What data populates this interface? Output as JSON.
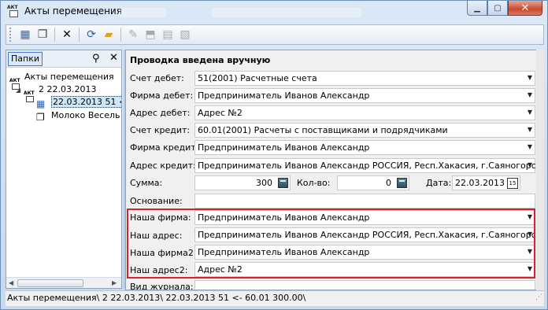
{
  "window": {
    "title": "Акты перемещения",
    "title_icon_text": "АКТ"
  },
  "toolbar": {
    "buttons": [
      "new-doc-icon",
      "copy-icon",
      "delete-icon",
      "refresh-icon",
      "folder-icon",
      "eraser-icon",
      "stamp-icon",
      "post-icon",
      "unpost-icon"
    ]
  },
  "left_pane": {
    "tab_label": "Папки",
    "tree": [
      {
        "label": "Акты перемещения",
        "level": 0
      },
      {
        "label": "2 22.03.2013",
        "level": 1
      },
      {
        "label": "22.03.2013 51 <",
        "level": 2,
        "selected": true
      },
      {
        "label": "Молоко Весель",
        "level": 2
      }
    ]
  },
  "form": {
    "heading": "Проводка введена вручную",
    "debit_account_label": "Счет дебет:",
    "debit_account_value": "51(2001) Расчетные счета",
    "debit_firm_label": "Фирма дебет:",
    "debit_firm_value": "Предприниматель Иванов Александр",
    "debit_address_label": "Адрес дебет:",
    "debit_address_value": "Адрес №2",
    "credit_account_label": "Счет кредит:",
    "credit_account_value": "60.01(2001) Расчеты с поставщиками и подрядчиками",
    "credit_firm_label": "Фирма кредит:",
    "credit_firm_value": "Предприниматель Иванов Александр",
    "credit_address_label": "Адрес кредит:",
    "credit_address_value": "Предприниматель Иванов Александр РОССИЯ, Респ.Хакасия, г.Саяногорск",
    "sum_label": "Сумма:",
    "sum_value": "300",
    "qty_label": "Кол-во:",
    "qty_value": "0",
    "date_label": "Дата:",
    "date_value": "22.03.2013",
    "calendar_icon_text": "15",
    "basis_label": "Основание:",
    "basis_value": "",
    "our_firm_label": "Наша фирма:",
    "our_firm_value": "Предприниматель Иванов Александр",
    "our_address_label": "Наш адрес:",
    "our_address_value": "Предприниматель Иванов Александр РОССИЯ, Респ.Хакасия, г.Саяногорск",
    "our_firm2_label": "Наша фирма2:",
    "our_firm2_value": "Предприниматель Иванов Александр",
    "our_address2_label": "Наш адрес2:",
    "our_address2_value": "Адрес №2",
    "journal_label": "Вид журнала:"
  },
  "status_bar": {
    "text": "Акты перемещения\\ 2 22.03.2013\\ 22.03.2013 51 <- 60.01 300.00\\"
  },
  "colors": {
    "highlight_box": "#d9202c",
    "selection": "#cde6f7"
  }
}
